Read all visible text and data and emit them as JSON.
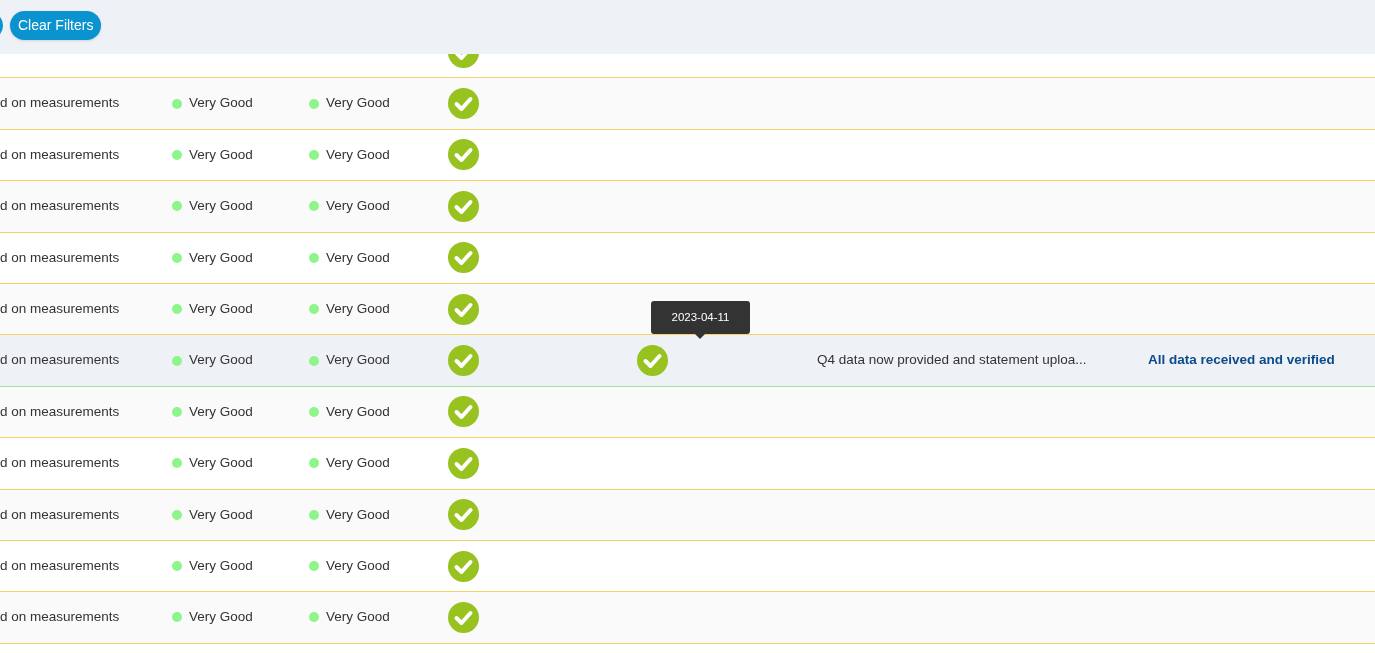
{
  "toolbar": {
    "buttons": [
      {
        "kind": "partial"
      },
      {
        "kind": "label",
        "label": "Clear Filters"
      }
    ]
  },
  "rows": [
    {
      "verified": true
    },
    {
      "hovered": false,
      "measurement": "d on measurements",
      "ratings": [
        {
          "label": "Very Good",
          "color": "#8ef58a"
        },
        {
          "label": "Very Good",
          "color": "#8ef58a"
        }
      ],
      "verified": true
    },
    {
      "hovered": false,
      "measurement": "d on measurements",
      "ratings": [
        {
          "label": "Very Good",
          "color": "#8ef58a"
        },
        {
          "label": "Very Good",
          "color": "#8ef58a"
        }
      ],
      "verified": true
    },
    {
      "hovered": false,
      "measurement": "d on measurements",
      "ratings": [
        {
          "label": "Very Good",
          "color": "#8ef58a"
        },
        {
          "label": "Very Good",
          "color": "#8ef58a"
        }
      ],
      "verified": true
    },
    {
      "hovered": false,
      "measurement": "d on measurements",
      "ratings": [
        {
          "label": "Very Good",
          "color": "#8ef58a"
        },
        {
          "label": "Very Good",
          "color": "#8ef58a"
        }
      ],
      "verified": true
    },
    {
      "hovered": false,
      "measurement": "d on measurements",
      "ratings": [
        {
          "label": "Very Good",
          "color": "#8ef58a"
        },
        {
          "label": "Very Good",
          "color": "#8ef58a"
        }
      ],
      "verified": true
    },
    {
      "hovered": true,
      "measurement": "d on measurements",
      "ratings": [
        {
          "label": "Very Good",
          "color": "#8ef58a"
        },
        {
          "label": "Very Good",
          "color": "#8ef58a"
        }
      ],
      "verified": true,
      "date_check": true,
      "tooltip": "2023-04-11",
      "comment": "Q4 data now provided and statement uploa...",
      "status": "All data received and verified"
    },
    {
      "hovered": false,
      "measurement": "d on measurements",
      "ratings": [
        {
          "label": "Very Good",
          "color": "#8ef58a"
        },
        {
          "label": "Very Good",
          "color": "#8ef58a"
        }
      ],
      "verified": true
    },
    {
      "hovered": false,
      "measurement": "d on measurements",
      "ratings": [
        {
          "label": "Very Good",
          "color": "#8ef58a"
        },
        {
          "label": "Very Good",
          "color": "#8ef58a"
        }
      ],
      "verified": true
    },
    {
      "hovered": false,
      "measurement": "d on measurements",
      "ratings": [
        {
          "label": "Very Good",
          "color": "#8ef58a"
        },
        {
          "label": "Very Good",
          "color": "#8ef58a"
        }
      ],
      "verified": true
    },
    {
      "hovered": false,
      "measurement": "d on measurements",
      "ratings": [
        {
          "label": "Very Good",
          "color": "#8ef58a"
        },
        {
          "label": "Very Good",
          "color": "#8ef58a"
        }
      ],
      "verified": true
    },
    {
      "hovered": false,
      "measurement": "d on measurements",
      "ratings": [
        {
          "label": "Very Good",
          "color": "#8ef58a"
        },
        {
          "label": "Very Good",
          "color": "#8ef58a"
        }
      ],
      "verified": true
    }
  ]
}
